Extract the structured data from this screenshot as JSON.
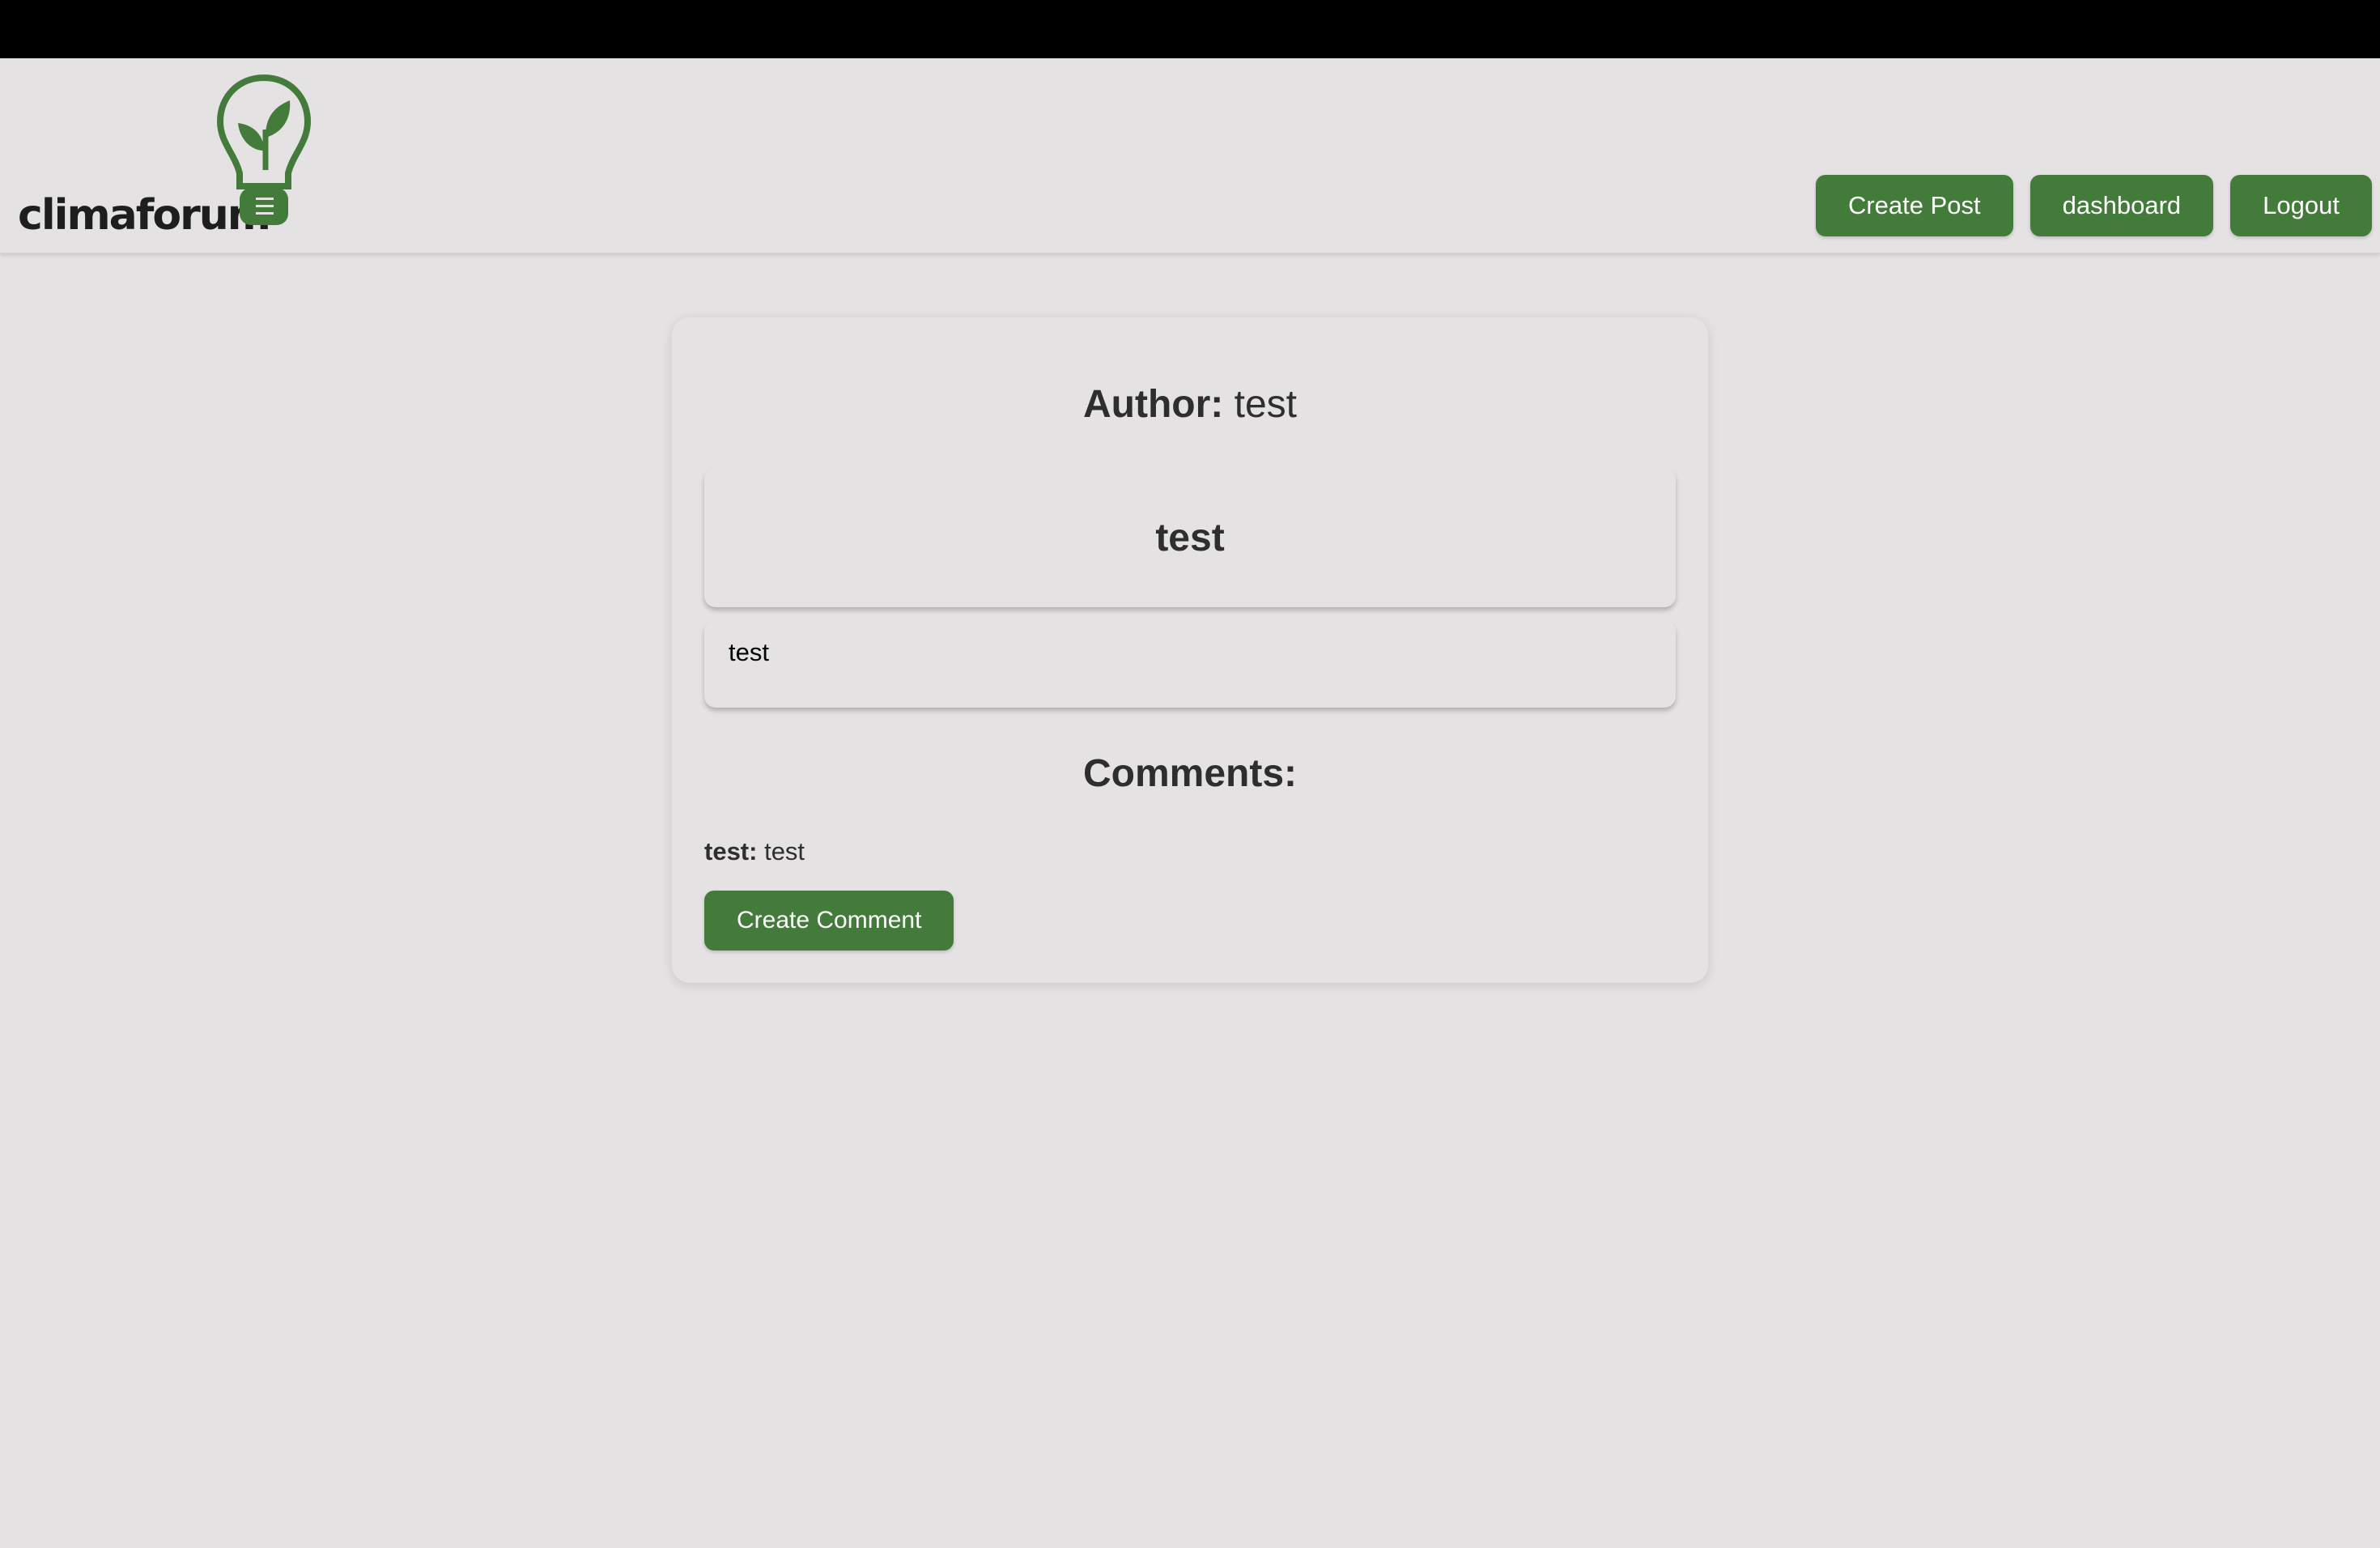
{
  "brand": {
    "name": "climaforum",
    "accent": "#437b3a"
  },
  "nav": {
    "create_post": "Create Post",
    "dashboard": "dashboard",
    "logout": "Logout"
  },
  "post": {
    "author_label": "Author:",
    "author": "test",
    "title": "test",
    "body": "test"
  },
  "comments": {
    "heading": "Comments:",
    "items": [
      {
        "user": "test:",
        "text": "test"
      }
    ],
    "create_label": "Create Comment"
  }
}
